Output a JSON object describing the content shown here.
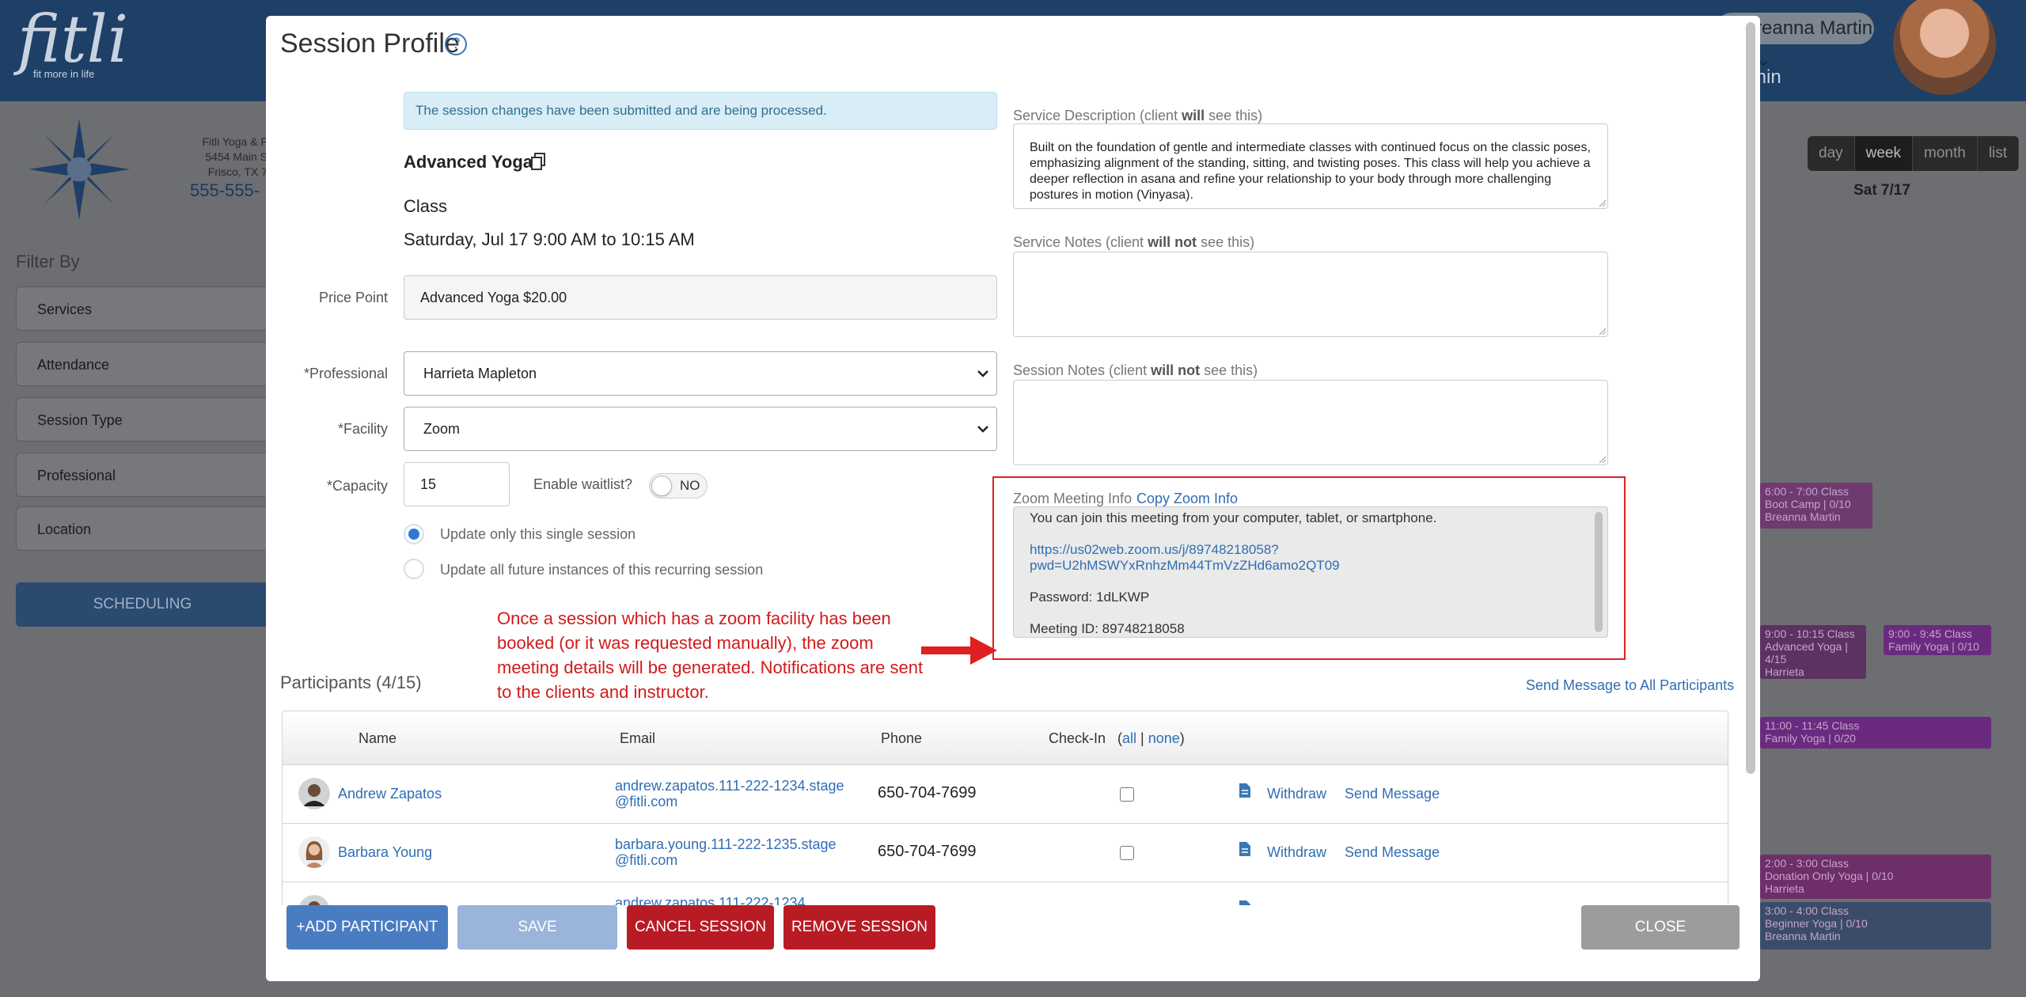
{
  "background": {
    "logo": "fitli",
    "logo_tagline": "fit more in life",
    "user_name": "reanna Martin",
    "user_role": "min",
    "address_lines": [
      "Fitli Yoga & F",
      "5454 Main S",
      "Frisco, TX 7"
    ],
    "phone": "555-555-",
    "filter_title": "Filter By",
    "filters": [
      "Services",
      "Attendance",
      "Session Type",
      "Professional",
      "Location"
    ],
    "scheduling_button": "SCHEDULING",
    "view_tabs": [
      "day",
      "week",
      "month",
      "list"
    ],
    "day_column": "Sat 7/17",
    "calendar_blocks": [
      {
        "time": "6:00 - 7:00",
        "tag": "Class",
        "title": "Boot Camp | 0/10",
        "who": "Breanna Martin"
      },
      {
        "time": "9:00 - 10:15",
        "tag": "Class",
        "title": "Advanced Yoga | 4/15",
        "who": "Harrieta"
      },
      {
        "time": "9:00 - 9:45",
        "tag": "Class",
        "title": "Family Yoga | 0/10",
        "who": ""
      },
      {
        "time": "11:00 - 11:45",
        "tag": "Class",
        "title": "Family Yoga | 0/20",
        "who": ""
      },
      {
        "time": "2:00 - 3:00",
        "tag": "Class",
        "title": "Donation Only Yoga | 0/10",
        "who": "Harrieta"
      },
      {
        "time": "3:00 - 4:00",
        "tag": "Class",
        "title": "Beginner Yoga | 0/10",
        "who": "Breanna Martin"
      }
    ]
  },
  "modal": {
    "title": "Session Profile",
    "help_glyph": "?",
    "alert": "The session changes have been submitted and are being processed.",
    "service_name": "Advanced Yoga",
    "session_type": "Class",
    "session_date": "Saturday, Jul 17   9:00 AM to 10:15 AM",
    "price_point_label": "Price Point",
    "price_point_value": "Advanced Yoga $20.00",
    "professional_label": "*Professional",
    "professional_value": "Harrieta Mapleton",
    "facility_label": "*Facility",
    "facility_value": "Zoom",
    "capacity_label": "*Capacity",
    "capacity_value": "15",
    "waitlist_label": "Enable waitlist?",
    "waitlist_toggle": "NO",
    "radio_single": "Update only this single session",
    "radio_all": "Update all future instances of this recurring session",
    "annotation": "Once a session which has a zoom facility has been booked (or it was requested manually), the zoom meeting details will be generated.  Notifications are sent to the clients and instructor.",
    "service_description_label_pre": "Service Description (client ",
    "service_description_label_bold": "will",
    "service_description_label_post": " see this)",
    "service_description": "Built on the foundation of gentle and intermediate classes with continued focus on the classic poses, emphasizing alignment of the standing, sitting, and twisting poses. This class will help you achieve a deeper reflection in asana and refine your relationship to your body through more challenging postures in motion (Vinyasa).",
    "service_notes_label_pre": "Service Notes (client ",
    "service_notes_label_bold": "will not",
    "service_notes_label_post": " see this)",
    "session_notes_label_pre": "Session Notes (client ",
    "session_notes_label_bold": "will not",
    "session_notes_label_post": " see this)",
    "zoom_label": "Zoom Meeting Info",
    "zoom_copy": "Copy Zoom Info",
    "zoom_intro": "You can join this meeting from your computer, tablet, or smartphone.",
    "zoom_link_1": "https://us02web.zoom.us/j/89748218058?",
    "zoom_link_2": "pwd=U2hMSWYxRnhzMm44TmVzZHd6amo2QT09",
    "zoom_password": "Password: 1dLKWP",
    "zoom_meeting_id": "Meeting ID: 89748218058",
    "participants_title": "Participants (4/15)",
    "send_all": "Send Message to All Participants",
    "columns": {
      "name": "Name",
      "email": "Email",
      "phone": "Phone",
      "checkin": "Check-In",
      "all": "all",
      "none": "none"
    },
    "participants": [
      {
        "name": "Andrew Zapatos",
        "email": "andrew.zapatos.111-222-1234.stage@fitli.com",
        "phone": "650-704-7699"
      },
      {
        "name": "Barbara Young",
        "email": "barbara.young.111-222-1235.stage@fitli.com",
        "phone": "650-704-7699"
      },
      {
        "name": "",
        "email": "andrew.zapatos.111-222-1234",
        "phone": ""
      }
    ],
    "withdraw": "Withdraw",
    "send_message": "Send Message",
    "buttons": {
      "add": "+ADD PARTICIPANT",
      "save": "SAVE",
      "cancel_session": "CANCEL SESSION",
      "remove_session": "REMOVE SESSION",
      "close": "CLOSE"
    }
  },
  "colors": {
    "primary_blue": "#2f6eb3",
    "danger_red": "#b81b24",
    "annotation_red": "#d21a1a",
    "alert_bg": "#d9edf7"
  }
}
